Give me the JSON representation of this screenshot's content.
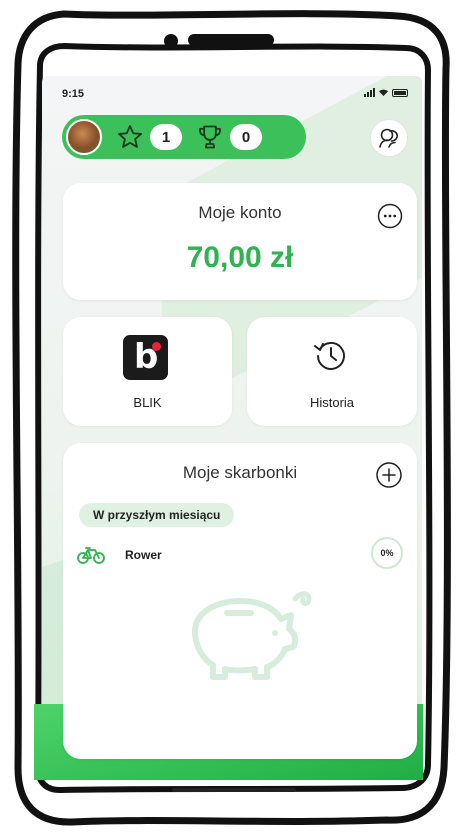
{
  "status_bar": {
    "time": "9:15"
  },
  "rewards": {
    "stars_count": "1",
    "trophies_count": "0"
  },
  "account": {
    "title": "Moje konto",
    "balance": "70,00 zł"
  },
  "tiles": {
    "blik_label": "BLIK",
    "history_label": "Historia"
  },
  "goals": {
    "title": "Moje skarbonki",
    "section_label": "W przyszłym miesiącu",
    "items": [
      {
        "name": "Rower",
        "icon": "bicycle-icon",
        "progress": "0%",
        "progress_fraction": 0
      }
    ]
  },
  "colors": {
    "brand_green": "#3cc15a",
    "balance_green": "#2db34f",
    "chip_green": "#dff2e2",
    "blik_dot_red": "#e8243c"
  }
}
